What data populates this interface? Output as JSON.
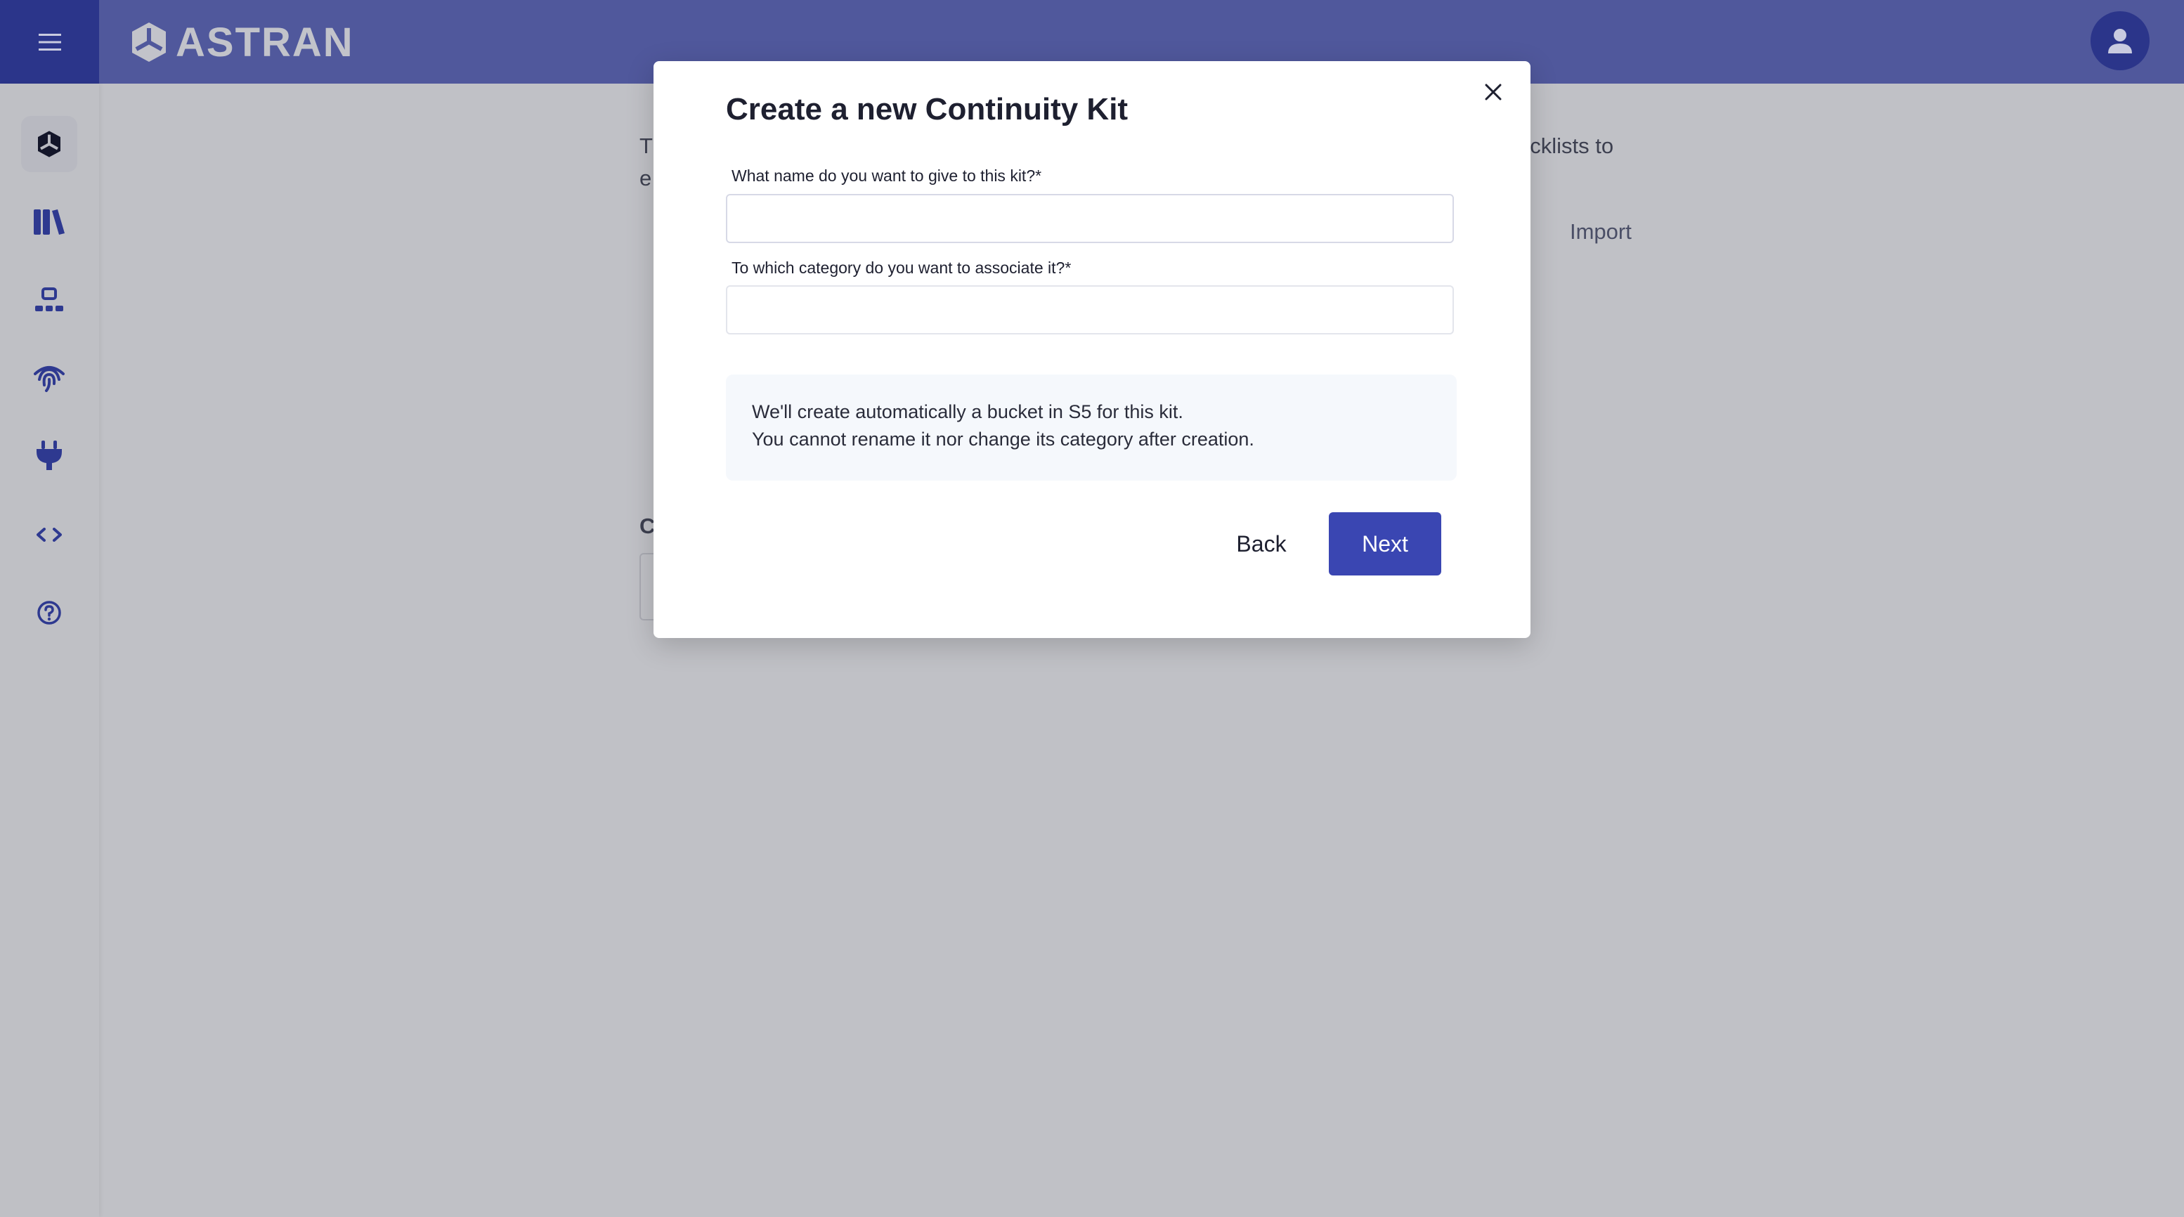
{
  "header": {
    "logo_text": "ASTRAN",
    "menu_icon": "hamburger-icon",
    "avatar_icon": "user-icon"
  },
  "sidebar": {
    "items": [
      {
        "name": "home",
        "icon": "astran-logo-icon",
        "active": true
      },
      {
        "name": "library",
        "icon": "books-icon"
      },
      {
        "name": "organization",
        "icon": "hierarchy-icon"
      },
      {
        "name": "identity",
        "icon": "fingerprint-icon"
      },
      {
        "name": "integrations",
        "icon": "plug-icon"
      },
      {
        "name": "developer",
        "icon": "code-icon"
      },
      {
        "name": "help",
        "icon": "help-circle-icon"
      }
    ]
  },
  "background": {
    "text_t": "T",
    "text_e": "e",
    "text_checklists": "ecklists to",
    "import_label": "Import",
    "text_c": "C"
  },
  "modal": {
    "title": "Create a new Continuity Kit",
    "name_label": "What name do you want to give to this kit?*",
    "name_value": "",
    "category_label": "To which category do you want to associate it?*",
    "category_value": "",
    "info_line1": "We'll create automatically a bucket in S5 for this kit.",
    "info_line2": "You cannot rename it nor change its category after creation.",
    "back_label": "Back",
    "next_label": "Next"
  },
  "colors": {
    "primary": "#3a46b2",
    "header": "#50589c",
    "menu": "#2b358a"
  }
}
